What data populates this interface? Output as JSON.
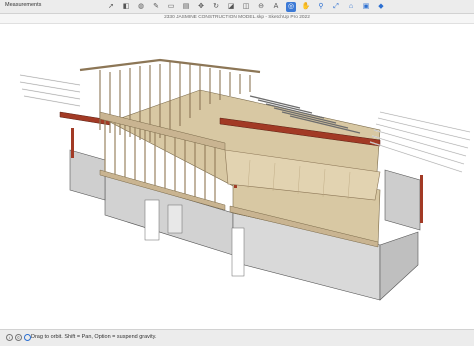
{
  "toolbar": {
    "measurements_label": "Measurements",
    "tools": [
      {
        "icon": "select-arrow-icon",
        "glyph": "➚"
      },
      {
        "icon": "eraser-icon",
        "glyph": "◧"
      },
      {
        "icon": "paint-bucket-icon",
        "glyph": "◍"
      },
      {
        "icon": "pencil-icon",
        "glyph": "✎"
      },
      {
        "icon": "rectangle-icon",
        "glyph": "▭"
      },
      {
        "icon": "push-pull-icon",
        "glyph": "▤"
      },
      {
        "icon": "move-icon",
        "glyph": "✥"
      },
      {
        "icon": "rotate-icon",
        "glyph": "↻"
      },
      {
        "icon": "scale-icon",
        "glyph": "◪"
      },
      {
        "icon": "offset-icon",
        "glyph": "◫"
      },
      {
        "icon": "tape-measure-icon",
        "glyph": "⊖"
      },
      {
        "icon": "text-icon",
        "glyph": "A"
      },
      {
        "icon": "orbit-icon",
        "glyph": "◎",
        "active": true
      },
      {
        "icon": "pan-hand-icon",
        "glyph": "✋"
      },
      {
        "icon": "zoom-icon",
        "glyph": "⚲"
      },
      {
        "icon": "zoom-extents-icon",
        "glyph": "⤢"
      },
      {
        "icon": "warehouse-icon",
        "glyph": "⌂"
      },
      {
        "icon": "extension-icon",
        "glyph": "▣"
      },
      {
        "icon": "section-plane-icon",
        "glyph": "◆"
      }
    ]
  },
  "window": {
    "title": "2330 JASMINE CONSTRUCTION MODEL.skp - SketchUp Pro 2022"
  },
  "status": {
    "message": "Drag to orbit. Shift = Pan, Option = suspend gravity."
  },
  "colors": {
    "wood_light": "#c9b491",
    "wood_dark": "#8c7656",
    "steel_red": "#a23a25",
    "concrete": "#d4d4d4",
    "osb_floor": "#d8c8a3",
    "active_tool": "#3d7ad6"
  }
}
